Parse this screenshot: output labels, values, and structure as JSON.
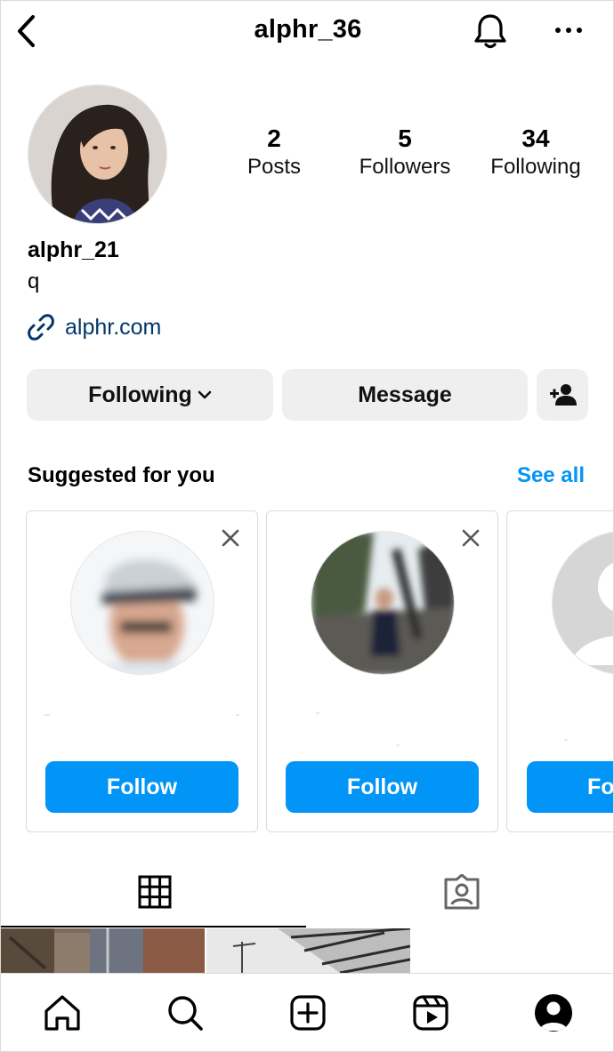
{
  "header": {
    "title": "alphr_36",
    "back_icon": "chevron-left-icon",
    "bell_icon": "bell-icon",
    "more_icon": "more-dots-icon"
  },
  "profile": {
    "username": "alphr_21",
    "bio": "q",
    "link": "alphr.com",
    "stats": [
      {
        "value": "2",
        "label": "Posts"
      },
      {
        "value": "5",
        "label": "Followers"
      },
      {
        "value": "34",
        "label": "Following"
      }
    ]
  },
  "actions": {
    "following_label": "Following",
    "message_label": "Message",
    "add_user_icon": "add-person-icon"
  },
  "suggested": {
    "title": "Suggested for you",
    "see_all": "See all",
    "cards": [
      {
        "follow_label": "Follow"
      },
      {
        "follow_label": "Follow"
      },
      {
        "follow_label": "Fo"
      }
    ]
  },
  "tabs": [
    {
      "icon": "grid-icon"
    },
    {
      "icon": "tagged-person-icon"
    }
  ],
  "bottom_nav": [
    {
      "icon": "home-icon"
    },
    {
      "icon": "search-icon"
    },
    {
      "icon": "create-post-icon"
    },
    {
      "icon": "reels-icon"
    },
    {
      "icon": "profile-icon"
    }
  ],
  "colors": {
    "accent": "#0095f6",
    "link": "#00376b",
    "button_bg": "#efefef",
    "border": "#dbdbdb"
  }
}
